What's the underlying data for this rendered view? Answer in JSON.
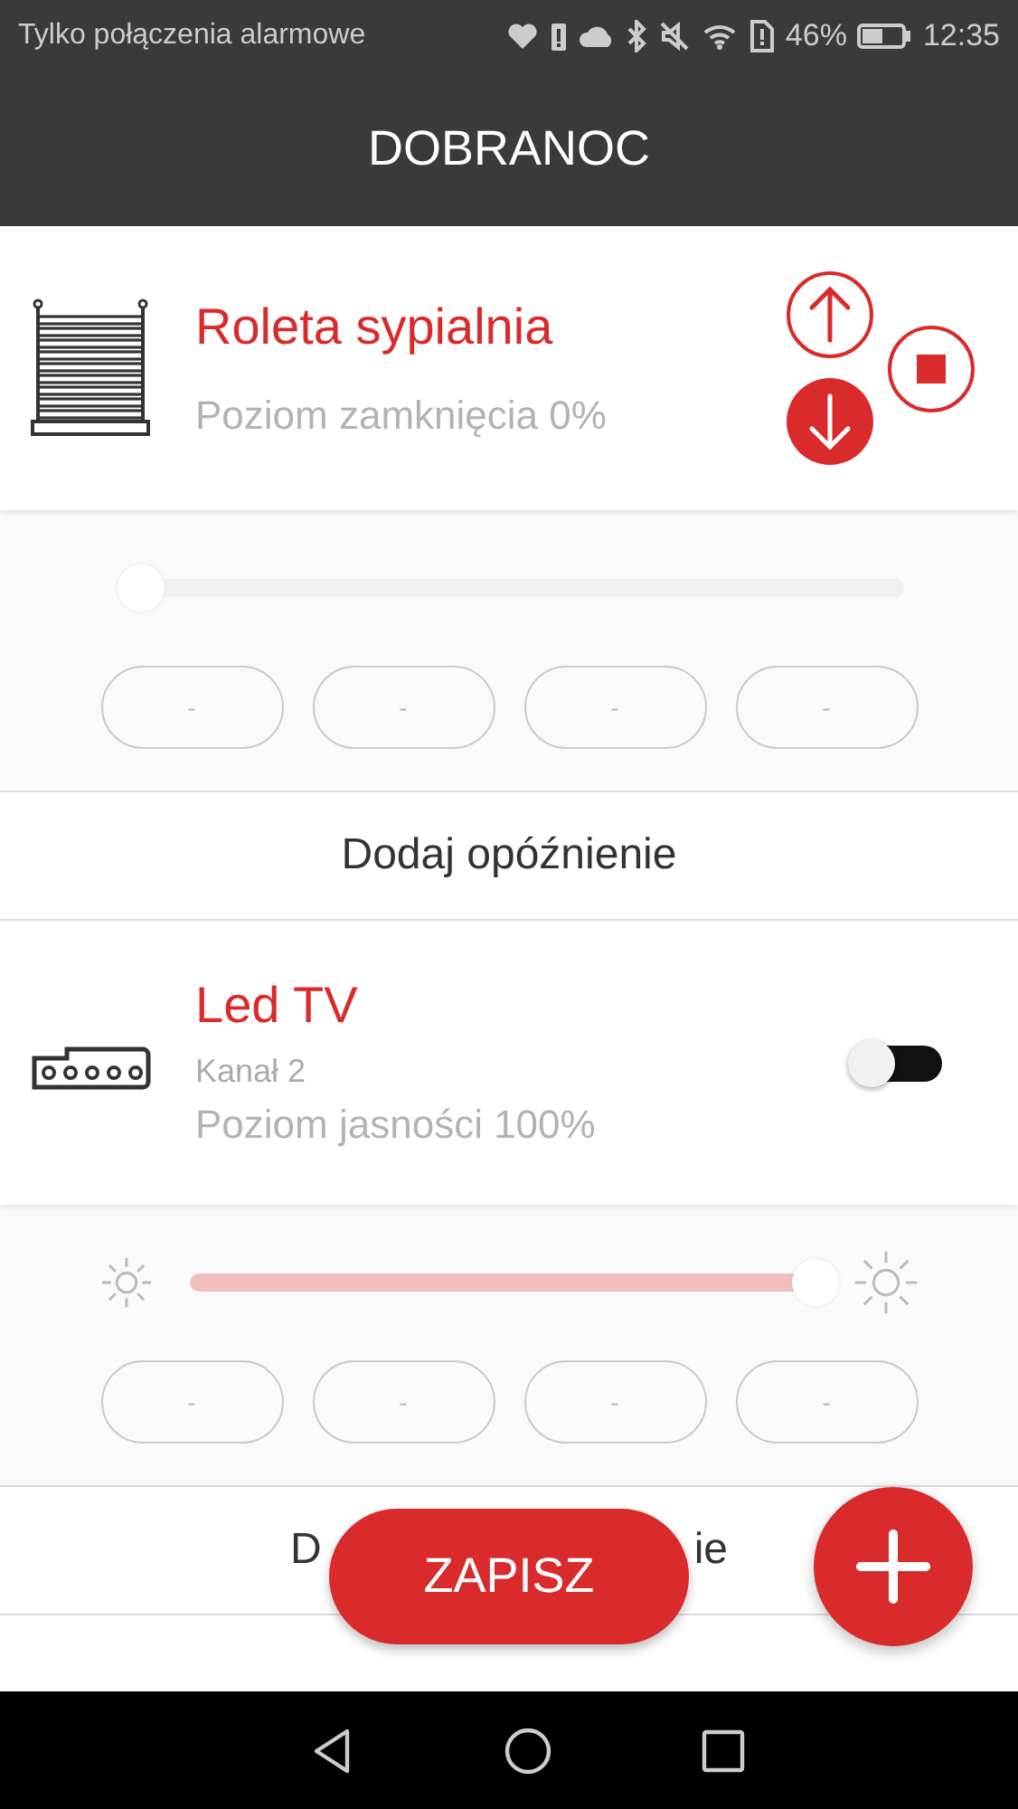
{
  "status_bar": {
    "notice": "Tylko połączenia alarmowe",
    "battery_percent": "46%",
    "time": "12:35"
  },
  "header": {
    "title": "DOBRANOC"
  },
  "devices": [
    {
      "kind": "blind",
      "name": "Roleta sypialnia",
      "status": "Poziom zamknięcia 0%",
      "buttons": [
        {
          "kind": "up",
          "selected": false
        },
        {
          "kind": "down",
          "selected": true
        },
        {
          "kind": "stop",
          "selected": false
        }
      ],
      "level": 0,
      "presets": [
        "-",
        "-",
        "-",
        "-"
      ],
      "action": [
        "Dodaj opóźnienie"
      ]
    },
    {
      "kind": "dimmer",
      "name": "Led TV",
      "channel": "Kanał 2",
      "status": "Poziom jasności 100%",
      "on": false,
      "level": 1,
      "presets": [
        "-",
        "-",
        "-",
        "-"
      ],
      "action": [
        "D",
        "ie"
      ]
    }
  ],
  "save_button": "ZAPISZ"
}
